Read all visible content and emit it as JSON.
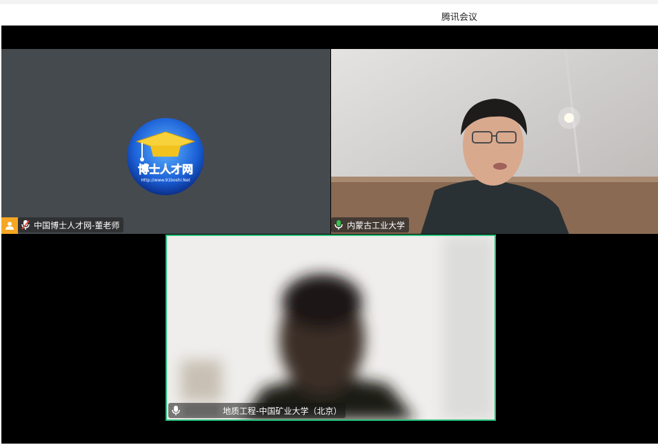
{
  "window": {
    "title": "腾讯会议"
  },
  "participants": [
    {
      "name": "中国博士人才网-董老师",
      "role": "host",
      "camera": "off",
      "avatar_logo": {
        "brand_text": "博士人才网",
        "url_text": "Http://www.91boshi.Net"
      }
    },
    {
      "name": "内蒙古工业大学",
      "camera": "on"
    },
    {
      "name": "地质工程-中国矿业大学（北京）",
      "camera": "on",
      "active_speaker": true
    }
  ],
  "colors": {
    "host_badge": "#f5a623",
    "active_speaker_border": "#27c17a",
    "mic_green": "#33c44f",
    "mic_muted_red": "#e0463a"
  }
}
